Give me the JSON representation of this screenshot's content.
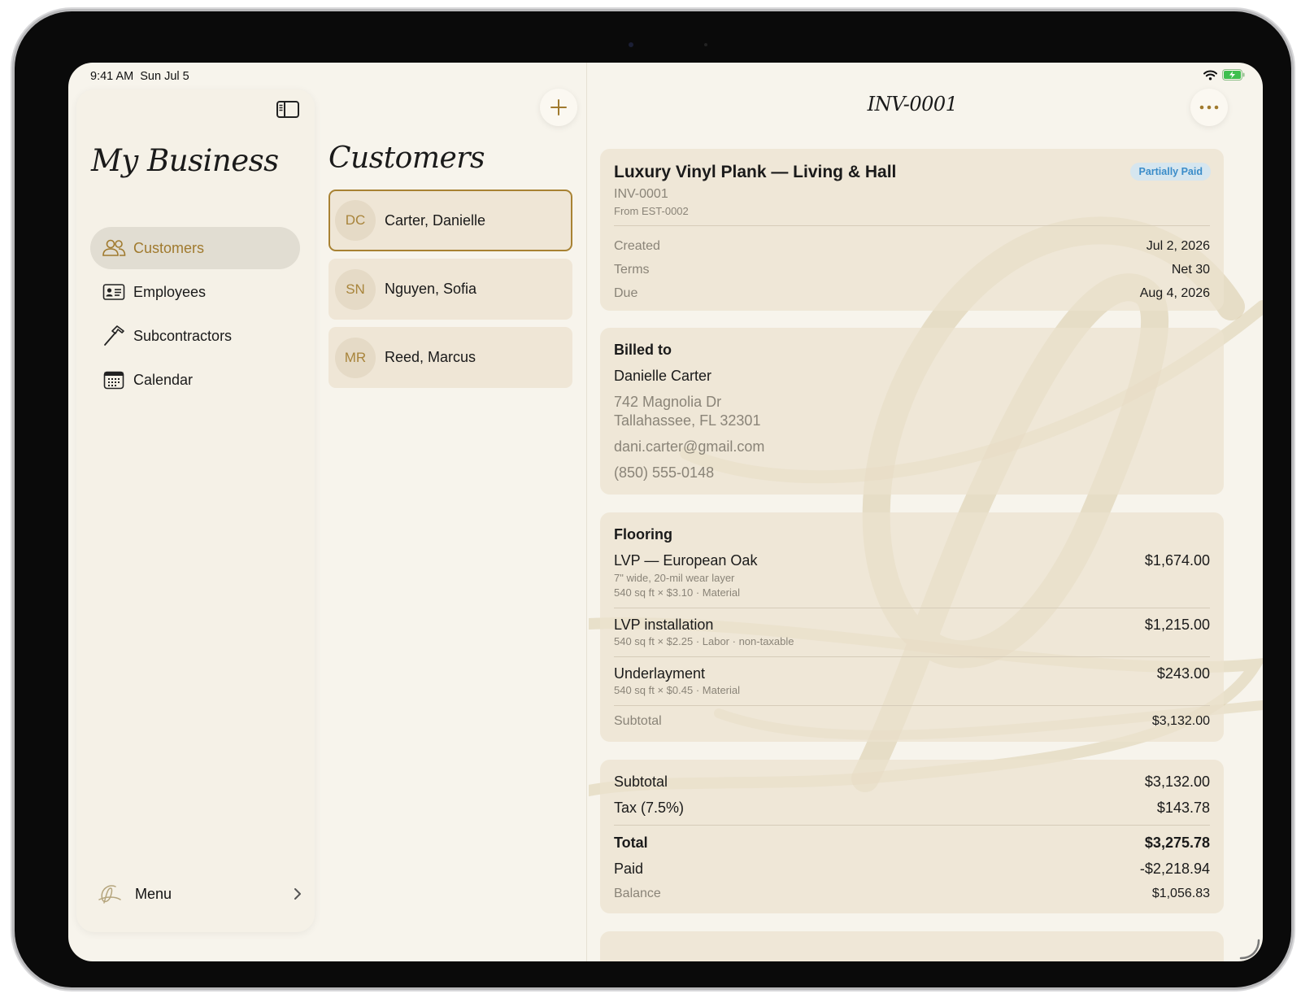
{
  "status_bar": {
    "time": "9:41 AM",
    "date": "Sun Jul 5",
    "icons": [
      "wifi-icon",
      "battery-charging-icon"
    ]
  },
  "sidebar": {
    "title": "My Business",
    "toggle_icon": "sidebar-toggle-icon",
    "items": [
      {
        "label": "Customers",
        "icon": "people-icon",
        "active": true
      },
      {
        "label": "Employees",
        "icon": "id-card-icon",
        "active": false
      },
      {
        "label": "Subcontractors",
        "icon": "hammer-icon",
        "active": false
      },
      {
        "label": "Calendar",
        "icon": "calendar-icon",
        "active": false
      }
    ],
    "menu": {
      "label": "Menu",
      "icon": "script-g-logo",
      "chevron": "chevron-right-icon"
    }
  },
  "customers": {
    "title": "Customers",
    "add_icon": "plus-icon",
    "list": [
      {
        "initials": "DC",
        "name": "Carter, Danielle",
        "selected": true
      },
      {
        "initials": "SN",
        "name": "Nguyen, Sofia",
        "selected": false
      },
      {
        "initials": "MR",
        "name": "Reed, Marcus",
        "selected": false
      }
    ]
  },
  "invoice": {
    "nav_title": "INV-0001",
    "more_icon": "ellipsis-icon",
    "job_title": "Luxury Vinyl Plank — Living & Hall",
    "status": "Partially Paid",
    "number": "INV-0001",
    "from": "From EST-0002",
    "dates": [
      {
        "k": "Created",
        "v": "Jul 2, 2026"
      },
      {
        "k": "Terms",
        "v": "Net 30"
      },
      {
        "k": "Due",
        "v": "Aug 4, 2026"
      }
    ],
    "billed_to": {
      "heading": "Billed to",
      "name": "Danielle Carter",
      "address1": "742 Magnolia Dr",
      "address2": "Tallahassee, FL 32301",
      "email": "dani.carter@gmail.com",
      "phone": "(850) 555-0148"
    },
    "section": {
      "heading": "Flooring",
      "items": [
        {
          "name": "LVP — European Oak",
          "desc": "7\" wide, 20-mil wear layer",
          "meta": "540 sq ft × $3.10  ·  Material",
          "price": "$1,674.00"
        },
        {
          "name": "LVP installation",
          "meta": "540 sq ft × $2.25  ·  Labor  · non-taxable",
          "price": "$1,215.00"
        },
        {
          "name": "Underlayment",
          "meta": "540 sq ft × $0.45  ·  Material",
          "price": "$243.00"
        }
      ],
      "subtotal_label": "Subtotal",
      "subtotal": "$3,132.00"
    },
    "totals": {
      "subtotal_label": "Subtotal",
      "subtotal": "$3,132.00",
      "tax_label": "Tax (7.5%)",
      "tax": "$143.78",
      "total_label": "Total",
      "total": "$3,275.78",
      "paid_label": "Paid",
      "paid": "-$2,218.94",
      "balance_label": "Balance",
      "balance": "$1,056.83"
    }
  },
  "colors": {
    "accent": "#a88233",
    "background": "#f7f4ec",
    "card": "#ece2cf",
    "badge_text": "#3a8cc9"
  }
}
